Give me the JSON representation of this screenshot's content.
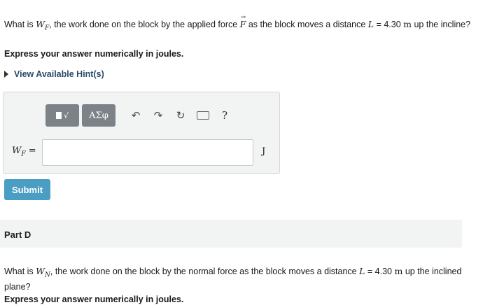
{
  "question_c": {
    "part1": "What is ",
    "var_symbol": "W",
    "var_sub": "F",
    "part2": ", the work done on the block by the applied force ",
    "force_symbol": "F",
    "part3": " as the block moves a distance ",
    "dist_symbol": "L",
    "eq": " = 4.30 ",
    "unit": "m",
    "part4": " up the incline?"
  },
  "instruction": "Express your answer numerically in joules.",
  "hint_link": "View Available Hint(s)",
  "toolbar": {
    "templates_label": "√",
    "symbols_label": "ΑΣφ",
    "undo_icon": "undo-icon",
    "redo_icon": "redo-icon",
    "reset_icon": "reset-icon",
    "keyboard_label": "kbd",
    "help_label": "?"
  },
  "answer": {
    "var_symbol": "W",
    "var_sub": "F",
    "equals": " =",
    "value": "",
    "unit": "J"
  },
  "submit_label": "Submit",
  "part_d": {
    "label": "Part D",
    "q_part1": "What is ",
    "var_symbol": "W",
    "var_sub": "N",
    "q_part2": ", the work done on the block by the normal force as the block moves a distance ",
    "dist_symbol": "L",
    "eq": " = 4.30 ",
    "unit": "m",
    "q_part3": " up the inclined plane?",
    "instruction": "Express your answer numerically in joules."
  }
}
